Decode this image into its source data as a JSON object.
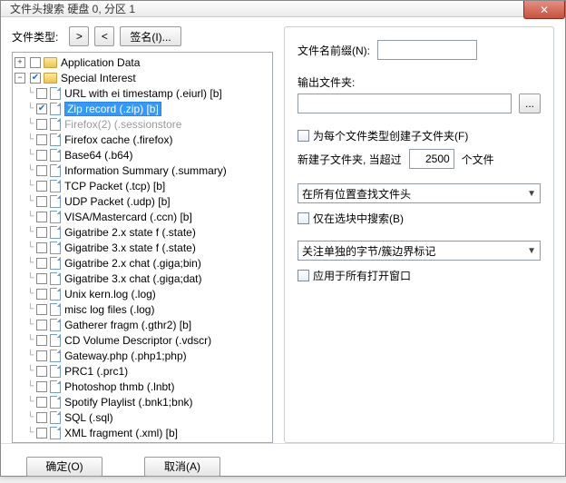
{
  "window": {
    "title": "文件头搜索 硬盘 0, 分区 1"
  },
  "left": {
    "type_label": "文件类型:",
    "btn_next": ">",
    "btn_prev": "<",
    "btn_sign": "签名(I)...",
    "tree": {
      "root1": {
        "label": "Application Data",
        "expanded": false
      },
      "root2": {
        "label": "Special Interest",
        "expanded": true,
        "checked": true
      },
      "items": [
        {
          "label": "URL with ei timestamp (.eiurl) [b]"
        },
        {
          "label": "Zip record (.zip) [b]",
          "checked": true,
          "selected": true
        },
        {
          "label": "Firefox(2) (.sessionstore",
          "faded": true
        },
        {
          "label": "Firefox cache (.firefox)"
        },
        {
          "label": "Base64 (.b64)"
        },
        {
          "label": "Information Summary (.summary)"
        },
        {
          "label": "TCP Packet (.tcp) [b]"
        },
        {
          "label": "UDP Packet (.udp) [b]"
        },
        {
          "label": "VISA/Mastercard (.ccn) [b]"
        },
        {
          "label": "Gigatribe 2.x state f (.state)"
        },
        {
          "label": "Gigatribe 3.x state f (.state)"
        },
        {
          "label": "Gigatribe 2.x chat (.giga;bin)"
        },
        {
          "label": "Gigatribe 3.x chat (.giga;dat)"
        },
        {
          "label": "Unix kern.log (.log)"
        },
        {
          "label": "misc log files (.log)"
        },
        {
          "label": "Gatherer fragm (.gthr2) [b]"
        },
        {
          "label": "CD Volume Descriptor (.vdscr)"
        },
        {
          "label": "Gateway.php (.php1;php)"
        },
        {
          "label": "PRC1 (.prc1)"
        },
        {
          "label": "Photoshop thmb (.lnbt)"
        },
        {
          "label": "Spotify Playlist (.bnk1;bnk)"
        },
        {
          "label": "SQL (.sql)"
        },
        {
          "label": "XML fragment (.xml) [b]"
        }
      ]
    }
  },
  "right": {
    "prefix_label": "文件名前缀(N):",
    "outdir_label": "输出文件夹:",
    "browse_btn": "...",
    "subfolder_chk": "为每个文件类型创建子文件夹(F)",
    "newfolder_label": "新建子文件夹, 当超过",
    "newfolder_value": "2500",
    "newfolder_suffix": "个文件",
    "search_scope": "在所有位置查找文件头",
    "block_only_chk": "仅在选块中搜索(B)",
    "boundary": "关注单独的字节/簇边界标记",
    "apply_all_chk": "应用于所有打开窗口"
  },
  "footer": {
    "ok": "确定(O)",
    "cancel": "取消(A)"
  }
}
